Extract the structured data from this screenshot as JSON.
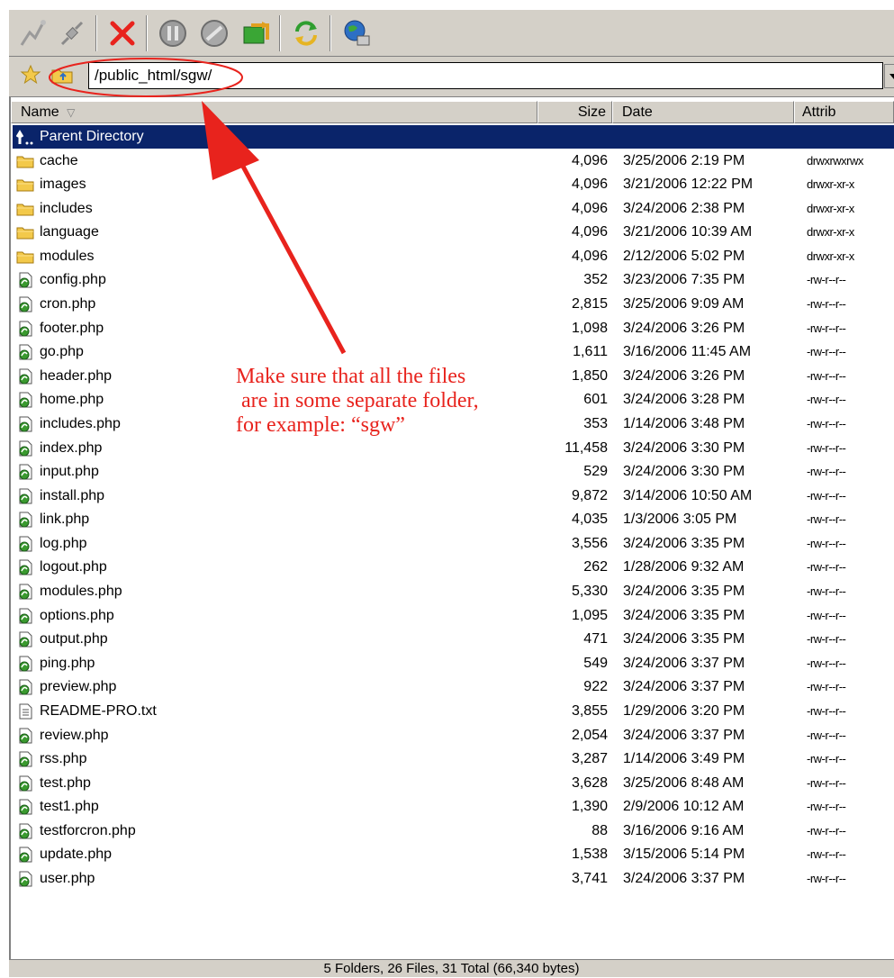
{
  "toolbar": {
    "buttons": [
      {
        "icon": "connect-icon"
      },
      {
        "icon": "disconnect-icon"
      },
      {
        "icon": "abort-icon",
        "color": "#e8231d"
      },
      {
        "icon": "pause-icon"
      },
      {
        "icon": "stop-icon"
      },
      {
        "icon": "transfer-icon"
      },
      {
        "icon": "refresh-icon"
      },
      {
        "icon": "site-manager-icon"
      }
    ]
  },
  "address": {
    "path": "/public_html/sgw/"
  },
  "columns": {
    "name": "Name",
    "size": "Size",
    "date": "Date",
    "attrib": "Attrib"
  },
  "files": [
    {
      "name": "Parent Directory",
      "size": "",
      "date": "",
      "attrib": "",
      "type": "parent",
      "selected": true
    },
    {
      "name": "cache",
      "size": "4,096",
      "date": "3/25/2006 2:19 PM",
      "attrib": "drwxrwxrwx",
      "type": "folder"
    },
    {
      "name": "images",
      "size": "4,096",
      "date": "3/21/2006 12:22 PM",
      "attrib": "drwxr-xr-x",
      "type": "folder"
    },
    {
      "name": "includes",
      "size": "4,096",
      "date": "3/24/2006 2:38 PM",
      "attrib": "drwxr-xr-x",
      "type": "folder"
    },
    {
      "name": "language",
      "size": "4,096",
      "date": "3/21/2006 10:39 AM",
      "attrib": "drwxr-xr-x",
      "type": "folder"
    },
    {
      "name": "modules",
      "size": "4,096",
      "date": "2/12/2006 5:02 PM",
      "attrib": "drwxr-xr-x",
      "type": "folder"
    },
    {
      "name": "config.php",
      "size": "352",
      "date": "3/23/2006 7:35 PM",
      "attrib": "-rw-r--r--",
      "type": "php"
    },
    {
      "name": "cron.php",
      "size": "2,815",
      "date": "3/25/2006 9:09 AM",
      "attrib": "-rw-r--r--",
      "type": "php"
    },
    {
      "name": "footer.php",
      "size": "1,098",
      "date": "3/24/2006 3:26 PM",
      "attrib": "-rw-r--r--",
      "type": "php"
    },
    {
      "name": "go.php",
      "size": "1,611",
      "date": "3/16/2006 11:45 AM",
      "attrib": "-rw-r--r--",
      "type": "php"
    },
    {
      "name": "header.php",
      "size": "1,850",
      "date": "3/24/2006 3:26 PM",
      "attrib": "-rw-r--r--",
      "type": "php"
    },
    {
      "name": "home.php",
      "size": "601",
      "date": "3/24/2006 3:28 PM",
      "attrib": "-rw-r--r--",
      "type": "php"
    },
    {
      "name": "includes.php",
      "size": "353",
      "date": "1/14/2006 3:48 PM",
      "attrib": "-rw-r--r--",
      "type": "php"
    },
    {
      "name": "index.php",
      "size": "11,458",
      "date": "3/24/2006 3:30 PM",
      "attrib": "-rw-r--r--",
      "type": "php"
    },
    {
      "name": "input.php",
      "size": "529",
      "date": "3/24/2006 3:30 PM",
      "attrib": "-rw-r--r--",
      "type": "php"
    },
    {
      "name": "install.php",
      "size": "9,872",
      "date": "3/14/2006 10:50 AM",
      "attrib": "-rw-r--r--",
      "type": "php"
    },
    {
      "name": "link.php",
      "size": "4,035",
      "date": "1/3/2006 3:05 PM",
      "attrib": "-rw-r--r--",
      "type": "php"
    },
    {
      "name": "log.php",
      "size": "3,556",
      "date": "3/24/2006 3:35 PM",
      "attrib": "-rw-r--r--",
      "type": "php"
    },
    {
      "name": "logout.php",
      "size": "262",
      "date": "1/28/2006 9:32 AM",
      "attrib": "-rw-r--r--",
      "type": "php"
    },
    {
      "name": "modules.php",
      "size": "5,330",
      "date": "3/24/2006 3:35 PM",
      "attrib": "-rw-r--r--",
      "type": "php"
    },
    {
      "name": "options.php",
      "size": "1,095",
      "date": "3/24/2006 3:35 PM",
      "attrib": "-rw-r--r--",
      "type": "php"
    },
    {
      "name": "output.php",
      "size": "471",
      "date": "3/24/2006 3:35 PM",
      "attrib": "-rw-r--r--",
      "type": "php"
    },
    {
      "name": "ping.php",
      "size": "549",
      "date": "3/24/2006 3:37 PM",
      "attrib": "-rw-r--r--",
      "type": "php"
    },
    {
      "name": "preview.php",
      "size": "922",
      "date": "3/24/2006 3:37 PM",
      "attrib": "-rw-r--r--",
      "type": "php"
    },
    {
      "name": "README-PRO.txt",
      "size": "3,855",
      "date": "1/29/2006 3:20 PM",
      "attrib": "-rw-r--r--",
      "type": "txt"
    },
    {
      "name": "review.php",
      "size": "2,054",
      "date": "3/24/2006 3:37 PM",
      "attrib": "-rw-r--r--",
      "type": "php"
    },
    {
      "name": "rss.php",
      "size": "3,287",
      "date": "1/14/2006 3:49 PM",
      "attrib": "-rw-r--r--",
      "type": "php"
    },
    {
      "name": "test.php",
      "size": "3,628",
      "date": "3/25/2006 8:48 AM",
      "attrib": "-rw-r--r--",
      "type": "php"
    },
    {
      "name": "test1.php",
      "size": "1,390",
      "date": "2/9/2006 10:12 AM",
      "attrib": "-rw-r--r--",
      "type": "php"
    },
    {
      "name": "testforcron.php",
      "size": "88",
      "date": "3/16/2006 9:16 AM",
      "attrib": "-rw-r--r--",
      "type": "php"
    },
    {
      "name": "update.php",
      "size": "1,538",
      "date": "3/15/2006 5:14 PM",
      "attrib": "-rw-r--r--",
      "type": "php"
    },
    {
      "name": "user.php",
      "size": "3,741",
      "date": "3/24/2006 3:37 PM",
      "attrib": "-rw-r--r--",
      "type": "php"
    }
  ],
  "status": "5 Folders, 26 Files, 31 Total (66,340 bytes)",
  "annotation": {
    "lines": [
      "Make sure that all the files",
      " are in some separate folder,",
      "for example: “sgw”"
    ],
    "color": "#e8231d"
  },
  "colors": {
    "selection": "#0a246a",
    "chrome": "#d4d0c8",
    "folder": "#f3c94a"
  }
}
